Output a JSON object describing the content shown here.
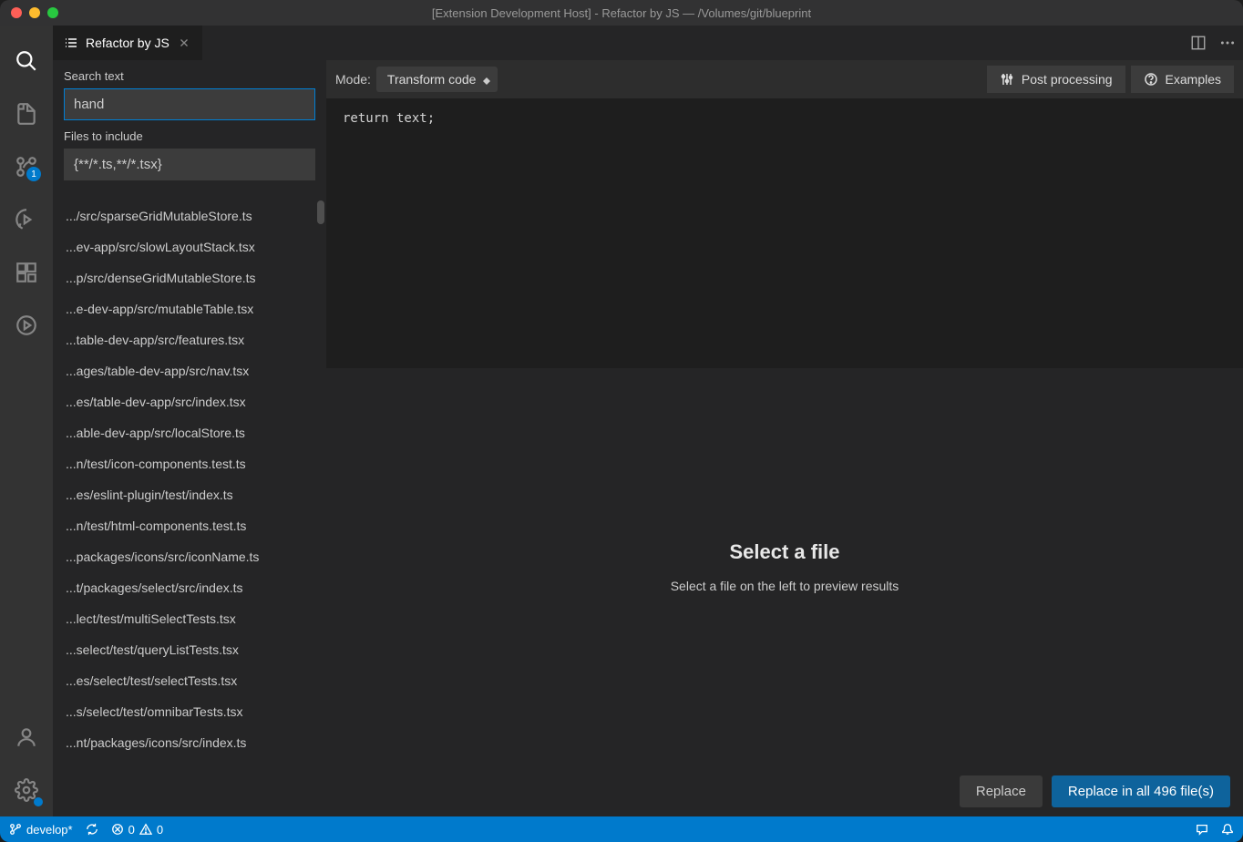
{
  "titlebar": {
    "text": "[Extension Development Host] - Refactor by JS — /Volumes/git/blueprint"
  },
  "activity_bar": {
    "scm_badge": "1"
  },
  "tab": {
    "title": "Refactor by JS"
  },
  "search": {
    "label": "Search text",
    "value": "hand"
  },
  "files_include": {
    "label": "Files to include",
    "value": "{**/*.ts,**/*.tsx}"
  },
  "file_list": [
    ".../src/sparseGridMutableStore.ts",
    "...ev-app/src/slowLayoutStack.tsx",
    "...p/src/denseGridMutableStore.ts",
    "...e-dev-app/src/mutableTable.tsx",
    "...table-dev-app/src/features.tsx",
    "...ages/table-dev-app/src/nav.tsx",
    "...es/table-dev-app/src/index.tsx",
    "...able-dev-app/src/localStore.ts",
    "...n/test/icon-components.test.ts",
    "...es/eslint-plugin/test/index.ts",
    "...n/test/html-components.test.ts",
    "...packages/icons/src/iconName.ts",
    "...t/packages/select/src/index.ts",
    "...lect/test/multiSelectTests.tsx",
    "...select/test/queryListTests.tsx",
    "...es/select/test/selectTests.tsx",
    "...s/select/test/omnibarTests.tsx",
    "...nt/packages/icons/src/index.ts"
  ],
  "mode_bar": {
    "label": "Mode:",
    "selected": "Transform code",
    "post_processing": "Post processing",
    "examples": "Examples"
  },
  "code": "return text;",
  "preview": {
    "title": "Select a file",
    "subtitle": "Select a file on the left to preview results"
  },
  "actions": {
    "replace": "Replace",
    "replace_all": "Replace in all 496 file(s)"
  },
  "status": {
    "branch": "develop*",
    "errors": "0",
    "warnings": "0"
  }
}
